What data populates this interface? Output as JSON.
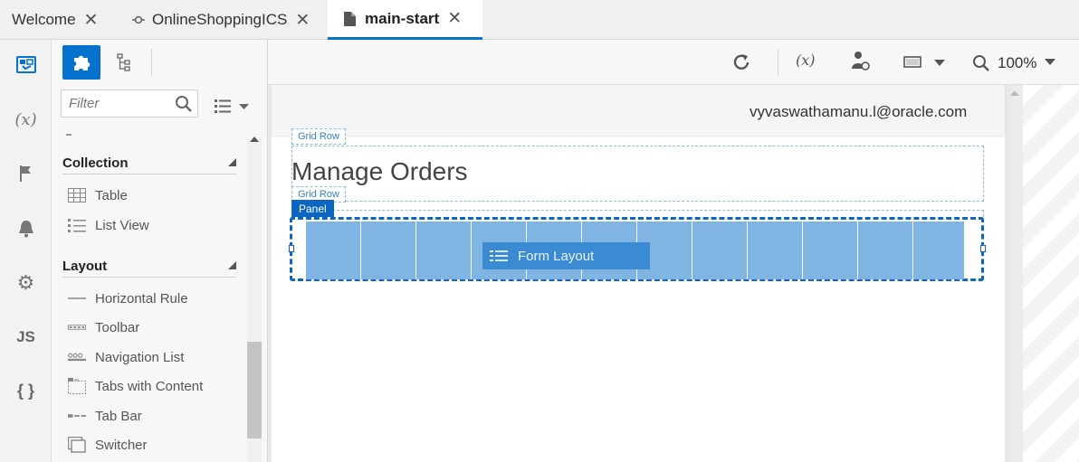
{
  "tabs": [
    {
      "label": "Welcome"
    },
    {
      "label": "OnlineShoppingICS"
    },
    {
      "label": "main-start"
    }
  ],
  "rail": {
    "icons": [
      "page-designer-icon",
      "variables-icon",
      "flag-icon",
      "bell-icon",
      "gear-icon",
      "js-icon",
      "json-icon"
    ],
    "variables_glyph": "(x)",
    "js_glyph": "JS",
    "json_glyph": "{ }"
  },
  "palette": {
    "filter_placeholder": "Filter",
    "sections": [
      {
        "title": "Collection",
        "items": [
          {
            "label": "Table",
            "icon": "table-icon"
          },
          {
            "label": "List View",
            "icon": "list-view-icon"
          }
        ]
      },
      {
        "title": "Layout",
        "items": [
          {
            "label": "Horizontal Rule",
            "icon": "horizontal-rule-icon"
          },
          {
            "label": "Toolbar",
            "icon": "toolbar-icon"
          },
          {
            "label": "Navigation List",
            "icon": "navigation-list-icon"
          },
          {
            "label": "Tabs with Content",
            "icon": "tabs-icon"
          },
          {
            "label": "Tab Bar",
            "icon": "tab-bar-icon"
          },
          {
            "label": "Switcher",
            "icon": "switcher-icon"
          }
        ]
      }
    ]
  },
  "toolbar": {
    "zoom": "100%"
  },
  "canvas": {
    "user_email": "vyvaswathamanu.l@oracle.com",
    "grid_row_label": "Grid Row",
    "heading": "Manage Orders",
    "panel_label": "Panel",
    "form_layout_label": "Form Layout"
  },
  "colors": {
    "accent": "#0572ce",
    "panel_fill": "#7fb4e3",
    "form_layout_fill": "#3a8bd1"
  }
}
